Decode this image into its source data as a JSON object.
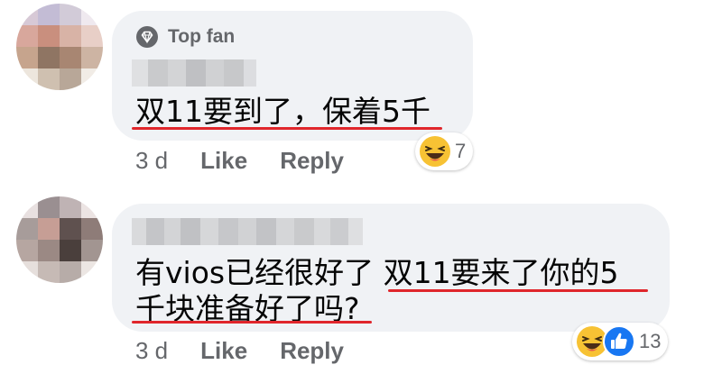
{
  "comments": [
    {
      "badge": "Top fan",
      "text": "双11要到了，保着5千",
      "time": "3 d",
      "like_label": "Like",
      "reply_label": "Reply",
      "reactions": [
        "laugh-emoji"
      ],
      "reaction_count": "7"
    },
    {
      "text_line1": "有vios已经很好了 双11要来了你的5",
      "text_line2": "千块准备好了吗?",
      "time": "3 d",
      "like_label": "Like",
      "reply_label": "Reply",
      "reactions": [
        "laugh-emoji",
        "like-emoji"
      ],
      "reaction_count": "13"
    }
  ],
  "colors": {
    "bubble": "#f0f2f5",
    "underline": "#e0262b",
    "like_blue": "#1877f2",
    "laugh_yellow": "#f7c234"
  }
}
